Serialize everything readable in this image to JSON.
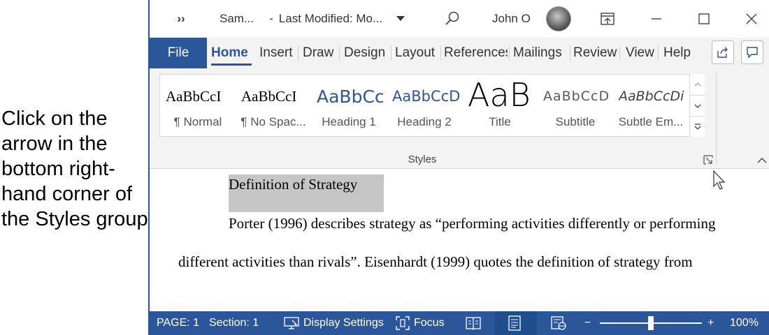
{
  "instruction": {
    "text": "Click on the arrow in the bottom right-hand corner of the Styles group"
  },
  "titlebar": {
    "qat_more": "››",
    "doc_name": "Sam...",
    "separator": "-",
    "last_modified": "Last Modified: Mo...",
    "user_name": "John O"
  },
  "tabs": {
    "file": "File",
    "items": [
      "Home",
      "Insert",
      "Draw",
      "Design",
      "Layout",
      "References",
      "Mailings",
      "Review",
      "View",
      "Help"
    ],
    "active": "Home"
  },
  "ribbon": {
    "styles": [
      {
        "sample": "AaBbCcI",
        "label": "¶ Normal"
      },
      {
        "sample": "AaBbCcI",
        "label": "¶ No Spac..."
      },
      {
        "sample": "AaBbCc",
        "label": "Heading 1"
      },
      {
        "sample": "AaBbCcD",
        "label": "Heading 2"
      },
      {
        "sample": "AaB",
        "label": "Title"
      },
      {
        "sample": "AaBbCcD",
        "label": "Subtitle"
      },
      {
        "sample": "AaBbCcDi",
        "label": "Subtle Em..."
      }
    ],
    "group_label": "Styles"
  },
  "document": {
    "heading": "Definition of Strategy",
    "line1": "Porter (1996) describes strategy as “performing activities differently or performing",
    "line2": "different activities than rivals”. Eisenhardt (1999) quotes the definition of strategy from"
  },
  "statusbar": {
    "page": "PAGE: 1",
    "section": "Section: 1",
    "display_settings": "Display Settings",
    "focus": "Focus",
    "zoom_minus": "−",
    "zoom_plus": "+",
    "zoom": "100%",
    "zoom_fraction": 0.5
  },
  "colors": {
    "accent": "#2b579a",
    "ribbon_bg": "#f3f3f3",
    "selection": "#c6c6c6",
    "heading_blue": "#2f5496"
  }
}
